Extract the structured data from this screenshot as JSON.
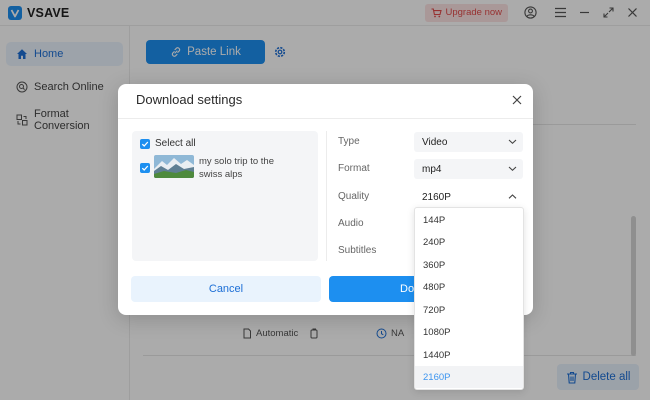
{
  "app": {
    "name": "VSAVE",
    "brand_color": "#1d8ff0"
  },
  "titlebar": {
    "upgrade_label": "Upgrade now",
    "icons": [
      "cart-icon",
      "account-icon",
      "menu-icon",
      "minimize-icon",
      "maximize-icon",
      "close-icon"
    ]
  },
  "sidebar": {
    "items": [
      {
        "label": "Home",
        "icon": "home-icon",
        "active": true
      },
      {
        "label": "Search Online",
        "icon": "search-icon",
        "active": false
      },
      {
        "label": "Format Conversion",
        "icon": "convert-icon",
        "active": false
      }
    ]
  },
  "main": {
    "paste_link_label": "Paste Link",
    "item_meta": {
      "quality": "Automatic",
      "size": "NA"
    },
    "delete_all_label": "Delete all"
  },
  "dialog": {
    "title": "Download settings",
    "select_all_label": "Select all",
    "file": {
      "title": "my solo trip to the swiss alps",
      "checked": true
    },
    "settings": {
      "type": {
        "label": "Type",
        "value": "Video"
      },
      "format": {
        "label": "Format",
        "value": "mp4"
      },
      "quality": {
        "label": "Quality",
        "value": "2160P"
      },
      "audio": {
        "label": "Audio"
      },
      "subtitles": {
        "label": "Subtitles"
      }
    },
    "cancel_label": "Cancel",
    "download_label_visible": "Do"
  },
  "quality_dropdown": {
    "options": [
      "144P",
      "240P",
      "360P",
      "480P",
      "720P",
      "1080P",
      "1440P",
      "2160P"
    ],
    "selected": "2160P"
  }
}
